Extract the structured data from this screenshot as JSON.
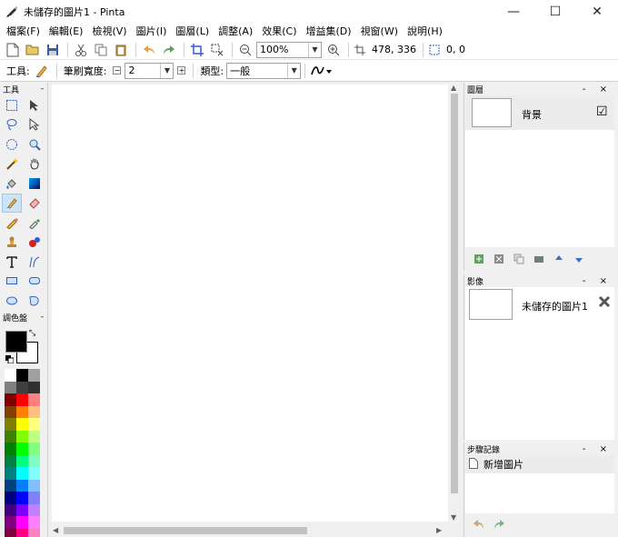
{
  "window": {
    "title": "未儲存的圖片1 - Pinta",
    "minimize": "—",
    "maximize": "☐",
    "close": "✕"
  },
  "menu": [
    "檔案(F)",
    "編輯(E)",
    "檢視(V)",
    "圖片(I)",
    "圖層(L)",
    "調整(A)",
    "效果(C)",
    "增益集(D)",
    "視窗(W)",
    "說明(H)"
  ],
  "toolbar": {
    "zoom_value": "100%",
    "cursor_position": "478, 336",
    "selection_size": "0, 0"
  },
  "tool_options": {
    "tool_label": "工具:",
    "brush_width_label": "筆刷寬度:",
    "brush_width_value": "2",
    "type_label": "類型:",
    "type_value": "一般"
  },
  "tools_panel": {
    "title": "工具",
    "collapse": "-"
  },
  "tools": [
    "rectangle-select",
    "move-selected",
    "lasso-select",
    "move-selection",
    "ellipse-select",
    "zoom",
    "magic-wand",
    "pan",
    "paint-bucket",
    "gradient",
    "paintbrush",
    "eraser",
    "pencil",
    "color-picker",
    "clone-stamp",
    "recolor",
    "text",
    "line-curve",
    "rectangle",
    "rounded-rectangle",
    "ellipse",
    "freeform-shape"
  ],
  "palette_panel": {
    "title": "調色盤",
    "collapse": "-"
  },
  "palette": {
    "primary": "#000000",
    "secondary": "#ffffff",
    "colors": [
      "#ffffff",
      "#000000",
      "#a0a0a0",
      "#808080",
      "#404040",
      "#303030",
      "#800000",
      "#ff0000",
      "#ff8080",
      "#804000",
      "#ff8000",
      "#ffc080",
      "#808000",
      "#ffff00",
      "#ffff80",
      "#408000",
      "#80ff00",
      "#c0ff80",
      "#008000",
      "#00ff00",
      "#80ff80",
      "#008040",
      "#00ff80",
      "#80ffc0",
      "#008080",
      "#00ffff",
      "#80ffff",
      "#004080",
      "#0080ff",
      "#80c0ff",
      "#000080",
      "#0000ff",
      "#8080ff",
      "#400080",
      "#8000ff",
      "#c080ff",
      "#800080",
      "#ff00ff",
      "#ff80ff",
      "#800040",
      "#ff0080",
      "#ff80c0"
    ]
  },
  "layers_panel": {
    "title": "圖層",
    "controls": "- ×",
    "items": [
      {
        "name": "背景",
        "visible": "☑"
      }
    ]
  },
  "images_panel": {
    "title": "影像",
    "controls": "- ×",
    "items": [
      {
        "name": "未儲存的圖片1"
      }
    ]
  },
  "history_panel": {
    "title": "步驟記錄",
    "controls": "- ×",
    "items": [
      {
        "name": "新增圖片"
      }
    ]
  }
}
